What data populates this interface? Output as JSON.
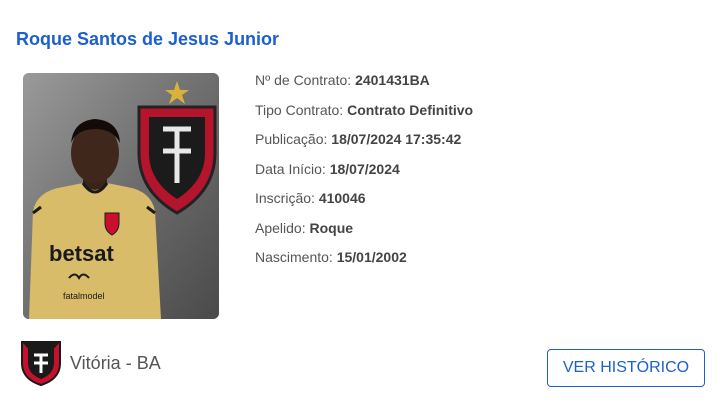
{
  "player": {
    "name": "Roque Santos de Jesus Junior",
    "photo_icon": "player-photo"
  },
  "details": [
    {
      "label": "Nº de Contrato:",
      "value": "2401431BA"
    },
    {
      "label": "Tipo Contrato:",
      "value": "Contrato Definitivo"
    },
    {
      "label": "Publicação:",
      "value": "18/07/2024 17:35:42"
    },
    {
      "label": "Data Início:",
      "value": "18/07/2024"
    },
    {
      "label": "Inscrição:",
      "value": "410046"
    },
    {
      "label": "Apelido:",
      "value": "Roque"
    },
    {
      "label": "Nascimento:",
      "value": "15/01/2002"
    }
  ],
  "club": {
    "name": "Vitória - BA",
    "crest_icon": "club-crest-icon"
  },
  "actions": {
    "history_label": "VER HISTÓRICO"
  },
  "colors": {
    "accent": "#1b5fd1",
    "label_text": "#555555",
    "value_text": "#444444",
    "club_red": "#c8102e",
    "jersey": "#d8bc6a"
  }
}
